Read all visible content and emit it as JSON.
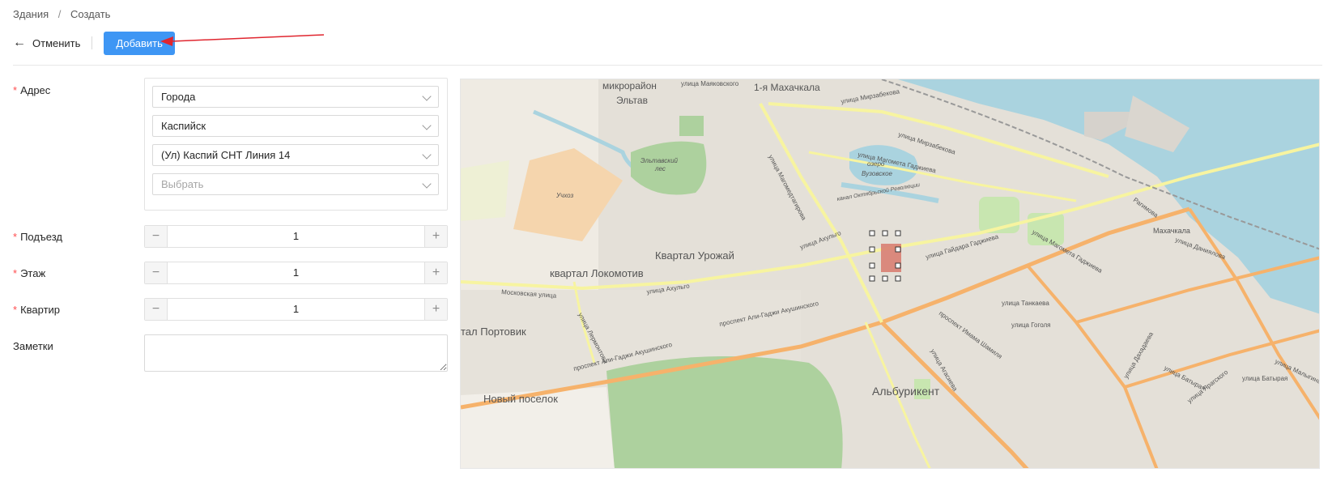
{
  "breadcrumb": {
    "parent": "Здания",
    "separator": "/",
    "current": "Создать"
  },
  "toolbar": {
    "cancel_label": "Отменить",
    "add_label": "Добавить"
  },
  "form": {
    "address": {
      "label": "Адрес",
      "selects": [
        {
          "value": "Города",
          "placeholder": false
        },
        {
          "value": "Каспийск",
          "placeholder": false
        },
        {
          "value": "(Ул) Каспий СНТ Линия 14",
          "placeholder": false
        },
        {
          "value": "Выбрать",
          "placeholder": true
        }
      ]
    },
    "entrance": {
      "label": "Подъезд",
      "value": "1"
    },
    "floor": {
      "label": "Этаж",
      "value": "1"
    },
    "apartment": {
      "label": "Квартир",
      "value": "1"
    },
    "notes": {
      "label": "Заметки",
      "value": ""
    }
  },
  "map": {
    "labels": {
      "mkr_eltav_1": "микрорайон",
      "mkr_eltav_2": "Эльтав",
      "st_mayak": "улица Маяковского",
      "makhachkala1": "1-я Махачкала",
      "st_mirzabekova": "улица Мирзабекова",
      "st_mirzabekova2": "улица Мирзабекова",
      "st_gadzhieva": "улица Магомета Гаджиева",
      "lake_1": "озеро",
      "lake_2": "Вузовское",
      "canal": "канал Октябрьской Революции",
      "forest_1": "Эльтавский",
      "forest_2": "лес",
      "uchkhoz": "Учхоз",
      "kvartal_urozh": "Квартал Урожай",
      "kvartal_lokom": "квартал Локомотив",
      "st_moskov": "Московская улица",
      "st_akhulgo": "улица Ахульго",
      "st_akhulgo2": "улица Ахульго",
      "pr_akushinskogo": "проспект Али-Гаджи Акушинского",
      "pr_akushinskogo2": "проспект Али-Гаджи Акушинского",
      "portovik": "тал Портовик",
      "novy_posel": "Новый поселок",
      "alburikent": "Альбурикент",
      "st_tankaeva": "улица Танкаева",
      "st_gogolya": "улица Гоголя",
      "pr_shamilya": "проспект Имама Шамиля",
      "st_gaidara": "улица Гайдара Гаджиева",
      "makhachkala": "Махачкала",
      "st_danialova": "улица Даниялова",
      "st_batyrai": "улица Батырая",
      "st_akhundova": "улица Агасиева",
      "st_dakhadaeva": "улица Дахадаева",
      "st_malygina": "улица Малыгина",
      "st_batyraya2": "улица Батырая",
      "st_magomedtagirova": "улица Магомедтагирова",
      "st_lermontova": "улица Лермонтова",
      "st_ozernaya": "улица Дахадаева",
      "st_yaraghskogo": "улица Ярагского",
      "gagarina": "Рагимова"
    }
  }
}
